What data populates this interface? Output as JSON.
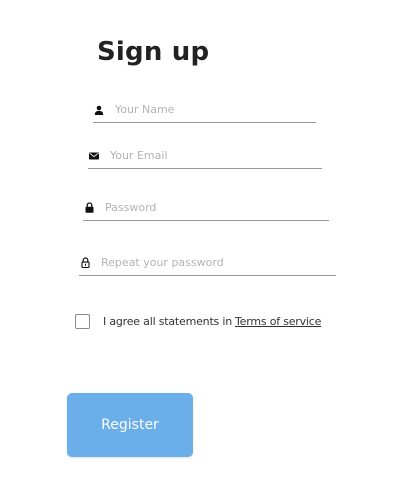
{
  "form": {
    "title": "Sign up",
    "fields": {
      "name": {
        "placeholder": "Your Name",
        "value": "",
        "icon": "user-icon"
      },
      "email": {
        "placeholder": "Your Email",
        "value": "",
        "icon": "envelope-icon"
      },
      "password": {
        "placeholder": "Password",
        "value": "",
        "icon": "lock-icon"
      },
      "repeat_password": {
        "placeholder": "Repeat your password",
        "value": "",
        "icon": "lock-outline-icon"
      }
    },
    "agree": {
      "checked": false,
      "text": "I agree all statements in",
      "link_text": "Terms of service"
    },
    "register_label": "Register"
  },
  "colors": {
    "accent": "#6aaeea",
    "title": "#222222",
    "underline": "#999999",
    "placeholder": "#b3b3b3"
  }
}
